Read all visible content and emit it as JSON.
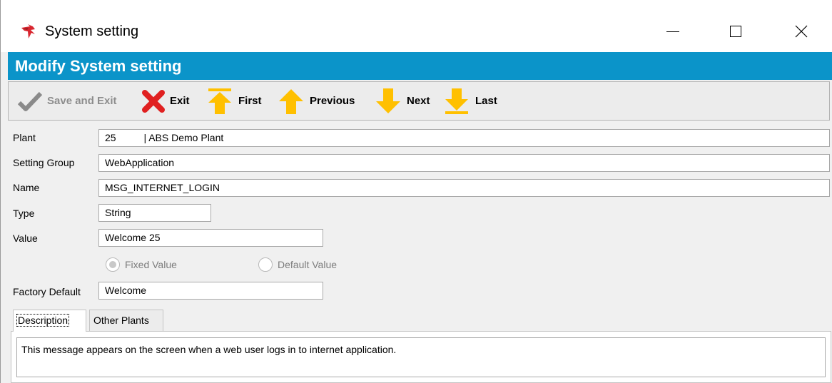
{
  "window": {
    "title": "System setting",
    "icon": "red-arrow-app-icon",
    "controls": [
      "minimize-icon",
      "maximize-icon",
      "close-icon"
    ]
  },
  "header": {
    "title": "Modify System setting",
    "color": "#0b94c9"
  },
  "toolbar": {
    "save_exit": "Save and Exit",
    "exit": "Exit",
    "first": "First",
    "previous": "Previous",
    "next": "Next",
    "last": "Last",
    "arrow_color": "#ffc000",
    "exit_color": "#e02020"
  },
  "form": {
    "plant": {
      "label": "Plant",
      "value": "25          | ABS Demo Plant"
    },
    "setting_group": {
      "label": "Setting Group",
      "value": "WebApplication"
    },
    "name": {
      "label": "Name",
      "value": "MSG_INTERNET_LOGIN"
    },
    "type": {
      "label": "Type",
      "value": "String"
    },
    "value": {
      "label": "Value",
      "value": "Welcome 25"
    },
    "fixed_value": {
      "label": "Fixed Value",
      "checked": true
    },
    "default_value": {
      "label": "Default Value",
      "checked": false
    },
    "factory_default": {
      "label": "Factory Default",
      "value": "Welcome"
    }
  },
  "tabs": [
    {
      "label": "Description",
      "active": true
    },
    {
      "label": "Other Plants",
      "active": false
    }
  ],
  "description": "This message appears on the screen when a web user logs in to internet application."
}
